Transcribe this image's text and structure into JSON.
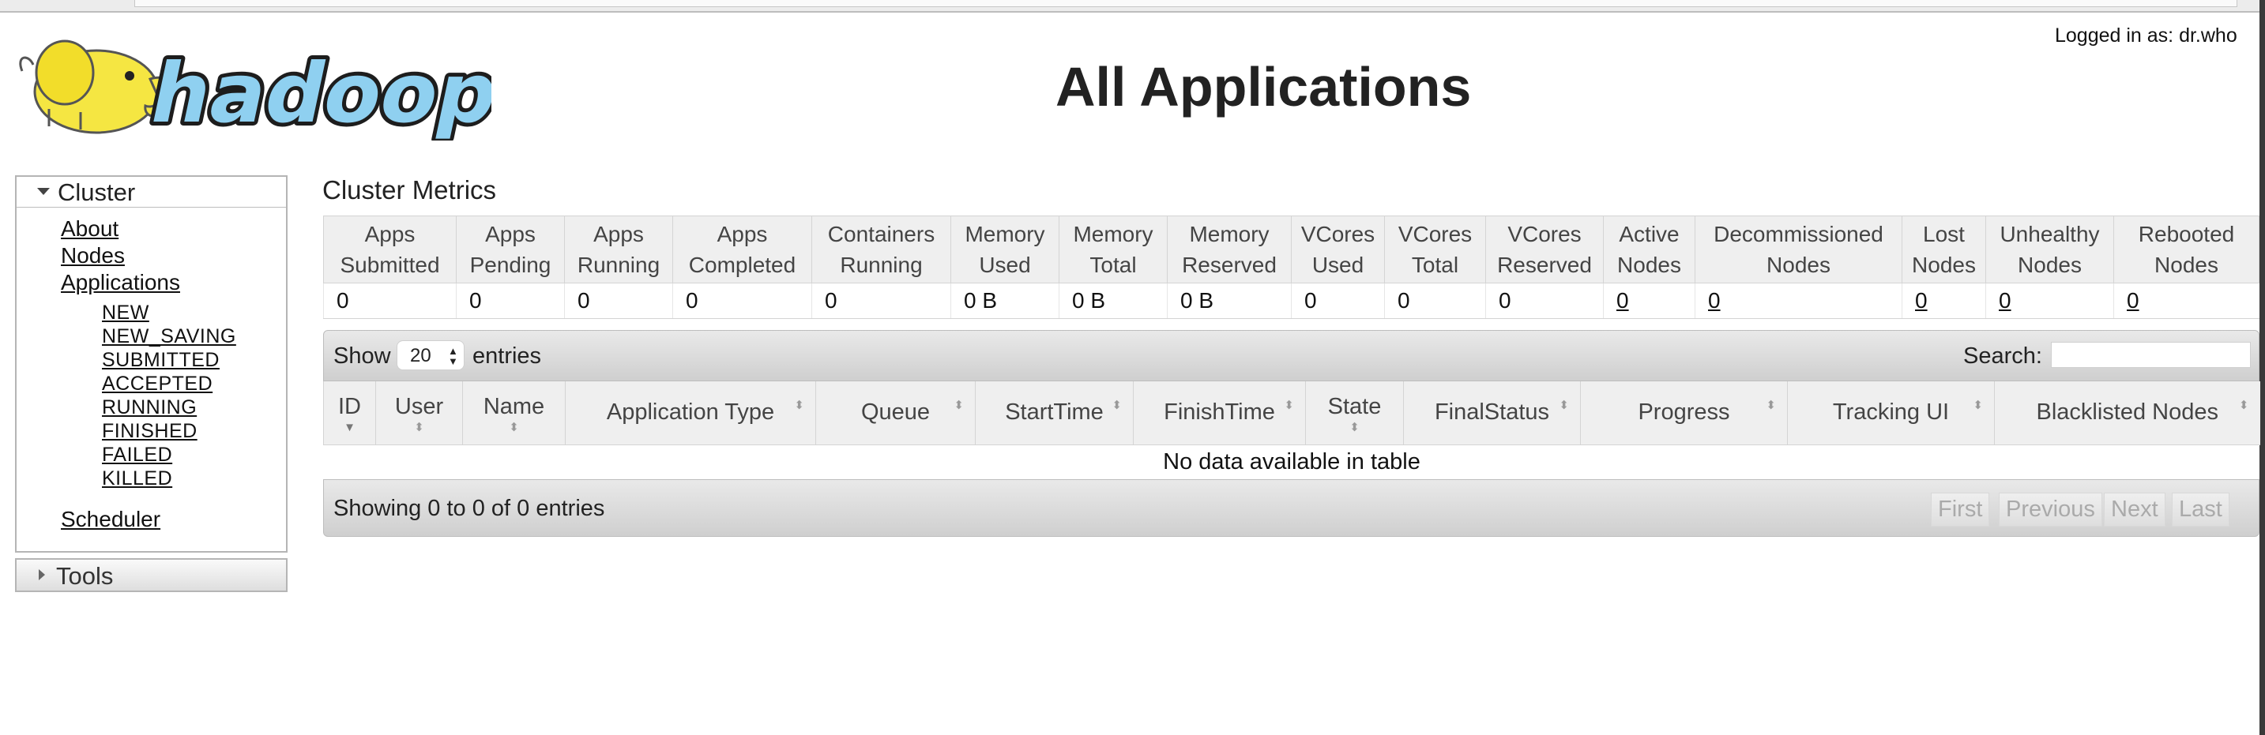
{
  "header": {
    "logo_text": "hadoop",
    "login_text": "Logged in as: dr.who",
    "title": "All Applications"
  },
  "sidebar": {
    "cluster_label": "Cluster",
    "links": [
      "About",
      "Nodes",
      "Applications"
    ],
    "app_states": [
      "NEW",
      "NEW_SAVING",
      "SUBMITTED",
      "ACCEPTED",
      "RUNNING",
      "FINISHED",
      "FAILED",
      "KILLED"
    ],
    "scheduler": "Scheduler",
    "tools_label": "Tools"
  },
  "metrics": {
    "title": "Cluster Metrics",
    "headers": [
      [
        "Apps",
        "Submitted"
      ],
      [
        "Apps",
        "Pending"
      ],
      [
        "Apps",
        "Running"
      ],
      [
        "Apps",
        "Completed"
      ],
      [
        "Containers",
        "Running"
      ],
      [
        "Memory",
        "Used"
      ],
      [
        "Memory",
        "Total"
      ],
      [
        "Memory",
        "Reserved"
      ],
      [
        "VCores",
        "Used"
      ],
      [
        "VCores",
        "Total"
      ],
      [
        "VCores",
        "Reserved"
      ],
      [
        "Active",
        "Nodes"
      ],
      [
        "Decommissioned",
        "Nodes"
      ],
      [
        "Lost",
        "Nodes"
      ],
      [
        "Unhealthy",
        "Nodes"
      ],
      [
        "Rebooted",
        "Nodes"
      ]
    ],
    "values": [
      "0",
      "0",
      "0",
      "0",
      "0",
      "0 B",
      "0 B",
      "0 B",
      "0",
      "0",
      "0",
      "0",
      "0",
      "0",
      "0",
      "0"
    ]
  },
  "apps_table": {
    "show_label": "Show",
    "page_size": "20",
    "entries_label": "entries",
    "search_label": "Search:",
    "search_value": "",
    "columns": [
      "ID",
      "User",
      "Name",
      "Application Type",
      "Queue",
      "StartTime",
      "FinishTime",
      "State",
      "FinalStatus",
      "Progress",
      "Tracking UI",
      "Blacklisted Nodes"
    ],
    "empty_message": "No data available in table",
    "info": "Showing 0 to 0 of 0 entries",
    "pager": [
      "First",
      "Previous",
      "Next",
      "Last"
    ]
  }
}
